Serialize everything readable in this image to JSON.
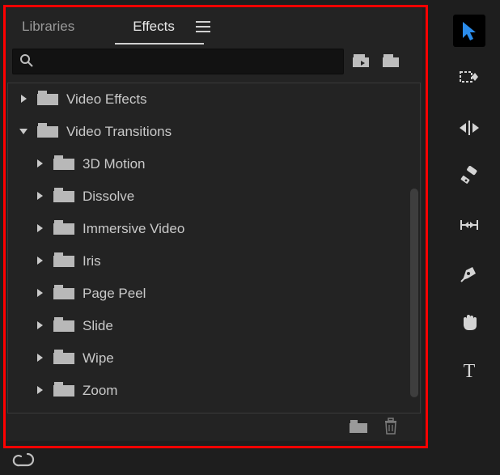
{
  "tabs": {
    "libraries": "Libraries",
    "effects": "Effects"
  },
  "active_tab": "effects",
  "search": {
    "value": "",
    "placeholder": ""
  },
  "tree": {
    "items": [
      {
        "label": "Video Effects",
        "expanded": false,
        "depth": 0
      },
      {
        "label": "Video Transitions",
        "expanded": true,
        "depth": 0
      },
      {
        "label": "3D Motion",
        "expanded": false,
        "depth": 1
      },
      {
        "label": "Dissolve",
        "expanded": false,
        "depth": 1
      },
      {
        "label": "Immersive Video",
        "expanded": false,
        "depth": 1
      },
      {
        "label": "Iris",
        "expanded": false,
        "depth": 1
      },
      {
        "label": "Page Peel",
        "expanded": false,
        "depth": 1
      },
      {
        "label": "Slide",
        "expanded": false,
        "depth": 1
      },
      {
        "label": "Wipe",
        "expanded": false,
        "depth": 1
      },
      {
        "label": "Zoom",
        "expanded": false,
        "depth": 1
      }
    ]
  },
  "icons": {
    "panel_menu": "panel-menu-icon",
    "search": "search-icon",
    "preset_bin": "preset-bin-icon",
    "new_bin": "new-bin-icon",
    "trash": "trash-icon",
    "cc_logo": "creative-cloud-icon"
  },
  "tools": [
    {
      "name": "selection-tool",
      "selected": true
    },
    {
      "name": "track-select-tool",
      "selected": false
    },
    {
      "name": "ripple-edit-tool",
      "selected": false
    },
    {
      "name": "razor-tool",
      "selected": false
    },
    {
      "name": "slip-tool",
      "selected": false
    },
    {
      "name": "pen-tool",
      "selected": false
    },
    {
      "name": "hand-tool",
      "selected": false
    },
    {
      "name": "type-tool",
      "selected": false
    }
  ]
}
